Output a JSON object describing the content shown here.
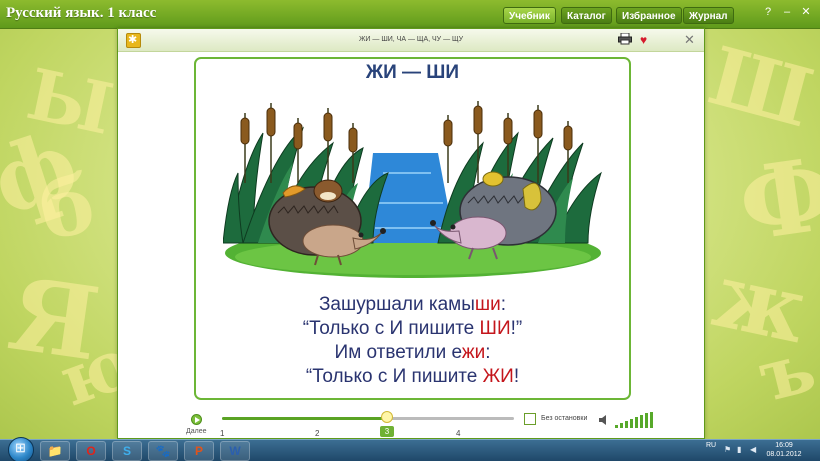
{
  "app": {
    "title": "Русский язык. 1 класс",
    "tabs": [
      "Учебник",
      "Каталог",
      "Избранное",
      "Журнал"
    ],
    "active_tab": "Учебник",
    "window_controls": {
      "help": "?",
      "minimize": "–",
      "close": "✕"
    }
  },
  "panel": {
    "title": "ЖИ — ШИ, ЧА — ЩА, ЧУ — ЩУ",
    "actions": {
      "print_icon": "printer-icon",
      "favorite_icon": "heart-icon",
      "close": "✕"
    }
  },
  "page": {
    "heading": "ЖИ — ШИ",
    "poem": [
      {
        "parts": [
          {
            "text": "Зашуршали камы",
            "hl": false
          },
          {
            "text": "ши",
            "hl": true
          },
          {
            "text": ":",
            "hl": false
          }
        ]
      },
      {
        "parts": [
          {
            "text": "“Только с И пишите ",
            "hl": false
          },
          {
            "text": "ШИ",
            "hl": true
          },
          {
            "text": "!”",
            "hl": false
          }
        ]
      },
      {
        "parts": [
          {
            "text": "Им ответили е",
            "hl": false
          },
          {
            "text": "жи",
            "hl": true
          },
          {
            "text": ":",
            "hl": false
          }
        ]
      },
      {
        "parts": [
          {
            "text": "“Только с И пишите ",
            "hl": false
          },
          {
            "text": "ЖИ",
            "hl": true
          },
          {
            "text": "!",
            "hl": false
          }
        ]
      }
    ],
    "highlight_color": "#c4161c",
    "text_color": "#2a3470"
  },
  "player": {
    "next_label": "Далее",
    "page_ticks": [
      "1",
      "2",
      "3",
      "4"
    ],
    "current_page": "3",
    "progress": 0.55,
    "no_stop_label": "Без остановки",
    "volume_level": 0.8
  },
  "taskbar": {
    "apps": [
      "folder-icon",
      "opera-icon",
      "skype-icon",
      "app-icon",
      "presentation-icon",
      "word-icon"
    ],
    "language": "RU",
    "time": "16:09",
    "date": "08.01.2012"
  },
  "colors": {
    "accent_green": "#6cb636",
    "titlebar_green": "#5f9a1b",
    "heading_blue": "#29437a"
  }
}
